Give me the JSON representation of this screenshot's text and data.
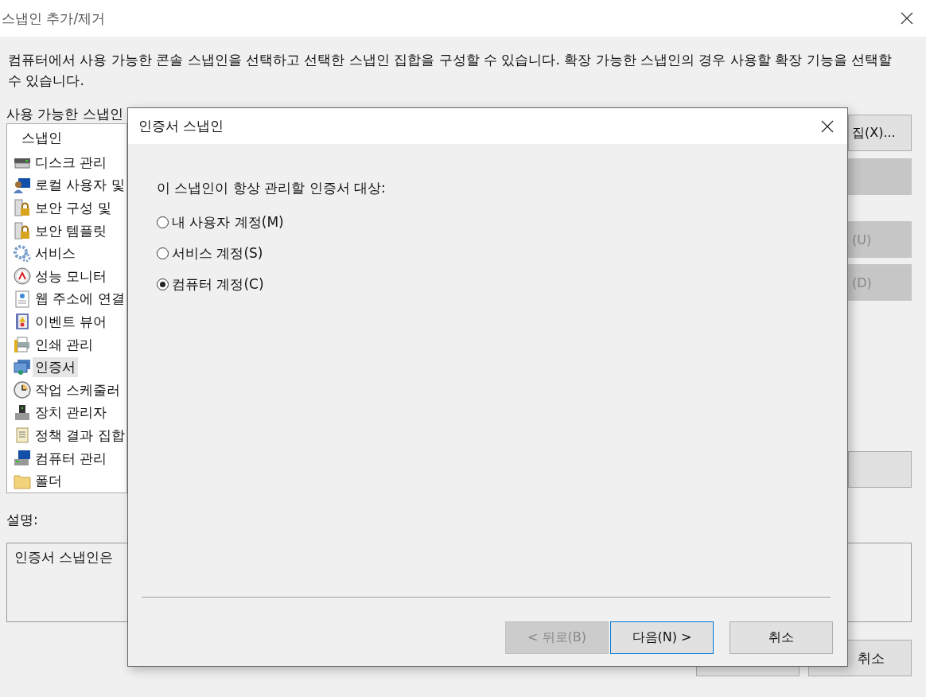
{
  "window": {
    "title": "스냅인 추가/제거"
  },
  "intro": "컴퓨터에서 사용 가능한 콘솔 스냅인을 선택하고 선택한 스냅인 집합을 구성할 수 있습니다. 확장 가능한 스냅인의 경우 사용할 확장 기능을 선택할 수 있습니다.",
  "available_label": "사용 가능한 스냅인",
  "snapin_list": {
    "column_1": "스냅인",
    "items": [
      {
        "label": "디스크 관리",
        "selected": false
      },
      {
        "label": "로컬 사용자 및",
        "selected": false
      },
      {
        "label": "보안 구성 및",
        "selected": false
      },
      {
        "label": "보안 템플릿",
        "selected": false
      },
      {
        "label": "서비스",
        "selected": false
      },
      {
        "label": "성능 모니터",
        "selected": false
      },
      {
        "label": "웹 주소에 연결",
        "selected": false
      },
      {
        "label": "이벤트 뷰어",
        "selected": false
      },
      {
        "label": "인쇄 관리",
        "selected": false
      },
      {
        "label": "인증서",
        "selected": true
      },
      {
        "label": "작업 스케줄러",
        "selected": false
      },
      {
        "label": "장치 관리자",
        "selected": false
      },
      {
        "label": "정책 결과 집합",
        "selected": false
      },
      {
        "label": "컴퓨터 관리",
        "selected": false
      },
      {
        "label": "폴더",
        "selected": false
      }
    ]
  },
  "side_buttons": [
    {
      "label": "집(X)...",
      "disabled": false
    },
    {
      "disabled": true
    },
    {
      "label": "(U)",
      "disabled": true
    },
    {
      "label": "(D)",
      "disabled": true
    },
    {
      "disabled": false
    }
  ],
  "description": {
    "label": "설명:",
    "text": "인증서 스냅인은"
  },
  "bottom_buttons": [
    {
      "label": "취소"
    }
  ],
  "dialog": {
    "title": "인증서 스냅인",
    "prompt": "이 스냅인이 항상 관리할 인증서 대상:",
    "options": [
      {
        "label": "내 사용자 계정(M)",
        "selected": false
      },
      {
        "label": "서비스 계정(S)",
        "selected": false
      },
      {
        "label": "컴퓨터 계정(C)",
        "selected": true
      }
    ],
    "buttons": [
      {
        "label": "< 뒤로(B)",
        "disabled": true,
        "focused": false
      },
      {
        "label": "다음(N) >",
        "disabled": false,
        "focused": true
      },
      {
        "label": "취소",
        "disabled": false,
        "focused": false
      }
    ]
  }
}
